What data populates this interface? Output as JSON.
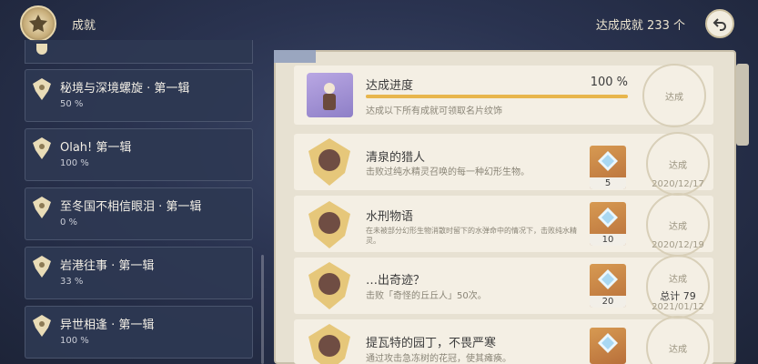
{
  "header": {
    "title": "成就",
    "count_label": "达成成就 233 个"
  },
  "categories": [
    {
      "name": "秘境与深境螺旋 · 第一辑",
      "pct": "50 %"
    },
    {
      "name": "Olah! 第一辑",
      "pct": "100 %"
    },
    {
      "name": "至冬国不相信眼泪 · 第一辑",
      "pct": "0 %"
    },
    {
      "name": "岩港往事 · 第一辑",
      "pct": "33 %"
    },
    {
      "name": "异世相逢 · 第一辑",
      "pct": "100 %"
    }
  ],
  "progress": {
    "title": "达成进度",
    "value": "100 %",
    "fraction": 1.0,
    "desc": "达成以下所有成就可领取名片纹饰",
    "seal": "达成"
  },
  "achievements": [
    {
      "name": "清泉的猎人",
      "desc": "击败过纯水精灵召唤的每一种幻形生物。",
      "reward_qty": "5",
      "seal": "达成",
      "seal_sub": "",
      "date": "2020/12/17"
    },
    {
      "name": "水刑物语",
      "desc": "在未被部分幻形生物消散时留下的水弹命中的情况下，击败纯水精灵。",
      "reward_qty": "10",
      "seal": "达成",
      "seal_sub": "",
      "date": "2020/12/19"
    },
    {
      "name": "…出奇迹？",
      "desc": "击败「奇怪的丘丘人」50次。",
      "reward_qty": "20",
      "seal": "达成",
      "seal_sub": "总计 79",
      "date": "2021/01/12"
    },
    {
      "name": "提瓦特的园丁，不畏严寒",
      "desc": "通过攻击急冻树的花冠，使其瘫痪。",
      "reward_qty": "",
      "seal": "达成",
      "seal_sub": "",
      "date": ""
    }
  ],
  "colors": {
    "accent_gold": "#e8b64c",
    "card_bg": "#f4efe4",
    "reward_bg": "#c9824a"
  },
  "icons": {
    "emblem": "achievement-emblem-icon",
    "back": "back-arrow-icon",
    "category": "trophy-icon",
    "reward": "primogem-icon"
  }
}
